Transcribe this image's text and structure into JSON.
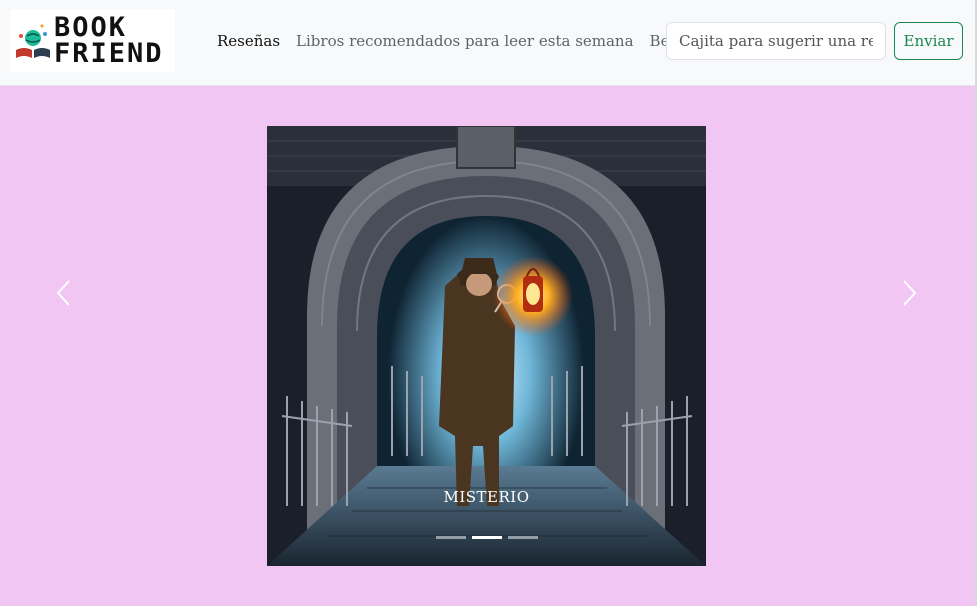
{
  "brand": {
    "line1": "BOOK",
    "line2": "FRIEND"
  },
  "nav": {
    "items": [
      {
        "label": "Reseñas",
        "active": true
      },
      {
        "label": "Libros recomendados para leer esta semana",
        "active": false
      },
      {
        "label": "Best Sellers",
        "active": false
      }
    ]
  },
  "suggest": {
    "placeholder": "Cajita para sugerir una reseña",
    "value": "",
    "button_label": "Enviar"
  },
  "carousel": {
    "caption": "MISTERIO",
    "slide_count": 3,
    "active_index": 1,
    "prev_icon": "chevron-left-icon",
    "next_icon": "chevron-right-icon"
  },
  "colors": {
    "page_background": "#f2c6f3",
    "navbar_background": "#f8f9fa",
    "accent_green": "#198754"
  }
}
